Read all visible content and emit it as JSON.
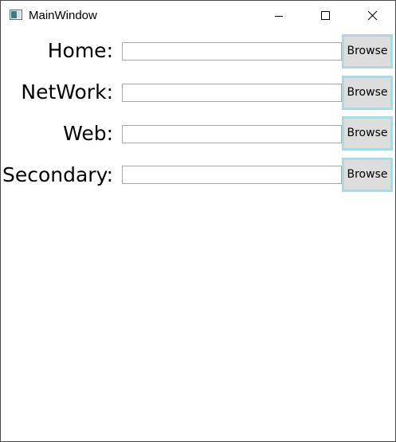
{
  "window": {
    "title": "MainWindow",
    "app_icon": "window-app-icon",
    "controls": {
      "minimize_icon": "minimize-icon",
      "maximize_icon": "maximize-icon",
      "close_icon": "close-icon"
    }
  },
  "rows": [
    {
      "label": "Home:",
      "value": "",
      "button_label": "Browse"
    },
    {
      "label": "NetWork:",
      "value": "",
      "button_label": "Browse"
    },
    {
      "label": "Web:",
      "value": "",
      "button_label": "Browse"
    },
    {
      "label": "Secondary:",
      "value": "",
      "button_label": "Browse"
    }
  ],
  "colors": {
    "button_background": "#dddddd",
    "button_border": "#add8e6",
    "input_border": "#a9a9a9",
    "window_border": "#4a4a4a"
  }
}
